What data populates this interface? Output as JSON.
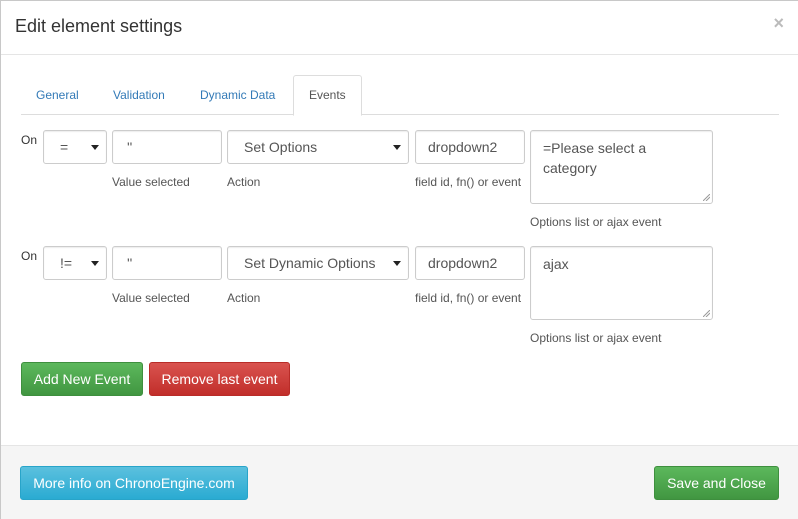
{
  "modal": {
    "title": "Edit element settings",
    "close_glyph": "×"
  },
  "tabs": [
    {
      "label": "General",
      "active": false
    },
    {
      "label": "Validation",
      "active": false
    },
    {
      "label": "Dynamic Data",
      "active": false
    },
    {
      "label": "Events",
      "active": true
    }
  ],
  "events": [
    {
      "on_label": "On",
      "operator": "=",
      "value": "''",
      "value_help": "Value selected",
      "action": "Set Options",
      "action_help": "Action",
      "target": "dropdown2",
      "target_help": "field id, fn() or event",
      "options": "=Please select a category",
      "options_help": "Options list or ajax event"
    },
    {
      "on_label": "On",
      "operator": "!=",
      "value": "''",
      "value_help": "Value selected",
      "action": "Set Dynamic Options",
      "action_help": "Action",
      "target": "dropdown2",
      "target_help": "field id, fn() or event",
      "options": "ajax",
      "options_help": "Options list or ajax event"
    }
  ],
  "buttons": {
    "add_event": "Add New Event",
    "remove_event": "Remove last event",
    "more_info": "More info on ChronoEngine.com",
    "save_close": "Save and Close"
  },
  "icons": {
    "close": "close-icon",
    "dropdown": "chevron-down-icon",
    "resize": "resize-handle-icon"
  },
  "colors": {
    "green": "#4cae4c",
    "red": "#d43f3a",
    "info": "#46b8da",
    "link": "#337ab7"
  }
}
